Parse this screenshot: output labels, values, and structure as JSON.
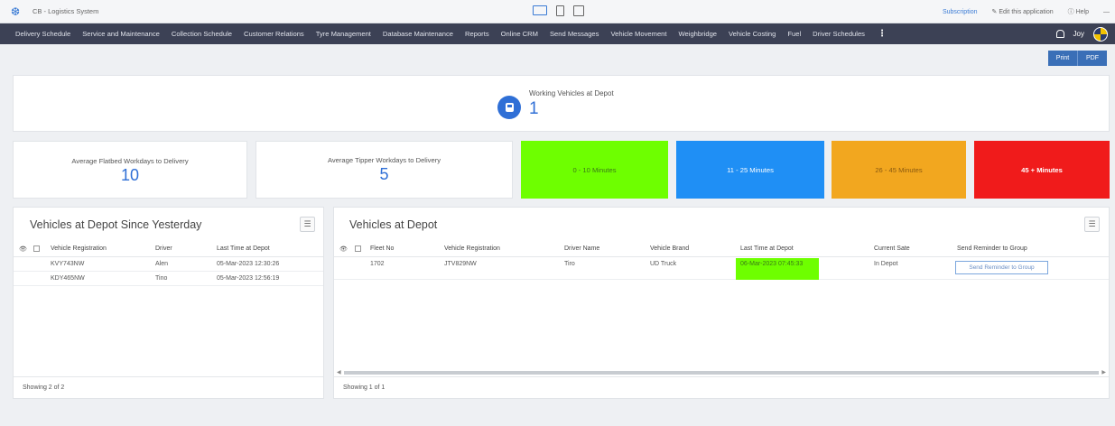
{
  "topbar": {
    "app_name": "CB - Logistics System",
    "subscription": "Subscription",
    "edit_app": "Edit this application",
    "help": "Help",
    "more": "—"
  },
  "nav": {
    "items": [
      "Delivery Schedule",
      "Service and Maintenance",
      "Collection Schedule",
      "Customer Relations",
      "Tyre Management",
      "Database Maintenance",
      "Reports",
      "Online CRM",
      "Send Messages",
      "Vehicle Movement",
      "Weighbridge",
      "Vehicle Costing",
      "Fuel",
      "Driver Schedules"
    ],
    "more": "⋮",
    "user": "Joy"
  },
  "actions": {
    "print": "Print",
    "pdf": "PDF"
  },
  "working": {
    "label": "Working Vehicles at Depot",
    "value": "1"
  },
  "stats": {
    "flatbed": {
      "label": "Average Flatbed Workdays to Delivery",
      "value": "10"
    },
    "tipper": {
      "label": "Average Tipper Workdays to Delivery",
      "value": "5"
    }
  },
  "bands": {
    "b1": "0 - 10 Minutes",
    "b2": "11 - 25 Minutes",
    "b3": "26 - 45 Minutes",
    "b4": "45 + Minutes"
  },
  "colors": {
    "green": "#6eff00",
    "blue": "#1f8ff5",
    "orange": "#f2a71f",
    "red": "#f01b1b",
    "nav": "#3c4155",
    "accent": "#2f6fd6"
  },
  "left_table": {
    "title": "Vehicles at Depot Since Yesterday",
    "columns": [
      "Vehicle Registration",
      "Driver",
      "Last Time at Depot"
    ],
    "rows": [
      {
        "reg": "KVY743NW",
        "driver": "Alen",
        "time": "05-Mar-2023 12:30:26"
      },
      {
        "reg": "KDY465NW",
        "driver": "Tino",
        "time": "05-Mar-2023 12:56:19"
      }
    ],
    "footer": "Showing 2 of 2"
  },
  "right_table": {
    "title": "Vehicles at Depot",
    "columns": [
      "Fleet No",
      "Vehicle Registration",
      "Driver Name",
      "Vehicle Brand",
      "Last Time at Depot",
      "Current Sate",
      "Send Reminder to Group"
    ],
    "rows": [
      {
        "fleet": "1702",
        "reg": "JTV829NW",
        "driver": "Tiro",
        "brand": "UD Truck",
        "time": "06-Mar-2023 07:45:33",
        "state": "In Depot",
        "action": "Send Reminder to Group"
      }
    ],
    "footer": "Showing 1 of 1"
  }
}
